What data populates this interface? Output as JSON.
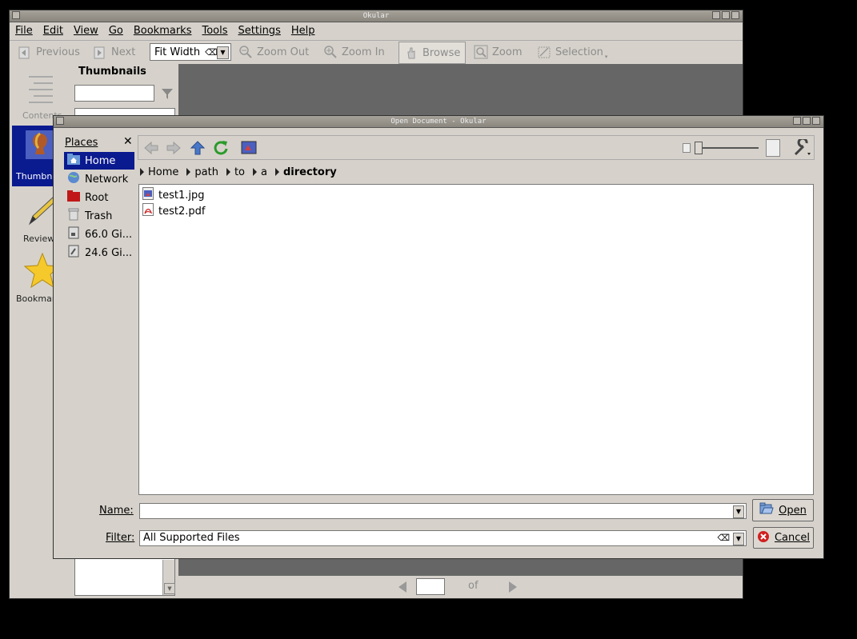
{
  "okular": {
    "title": "Okular",
    "menu": [
      "File",
      "Edit",
      "View",
      "Go",
      "Bookmarks",
      "Tools",
      "Settings",
      "Help"
    ],
    "toolbar": {
      "previous": "Previous",
      "next": "Next",
      "zoom_value": "Fit Width",
      "zoom_out": "Zoom Out",
      "zoom_in": "Zoom In",
      "browse": "Browse",
      "zoom": "Zoom",
      "selection": "Selection"
    },
    "side_tabs": [
      "Contents",
      "Thumbnails",
      "Reviews",
      "Bookmarks"
    ],
    "panel_title": "Thumbnails",
    "page_of": "of"
  },
  "dialog": {
    "title": "Open Document - Okular",
    "places_label": "Places",
    "places": [
      "Home",
      "Network",
      "Root",
      "Trash",
      "66.0 Gi...",
      "24.6 Gi..."
    ],
    "breadcrumb": [
      "Home",
      "path",
      "to",
      "a",
      "directory"
    ],
    "files": [
      "test1.jpg",
      "test2.pdf"
    ],
    "name_label": "Name:",
    "name_value": "",
    "filter_label": "Filter:",
    "filter_value": "All Supported Files",
    "open_label": "Open",
    "cancel_label": "Cancel"
  }
}
